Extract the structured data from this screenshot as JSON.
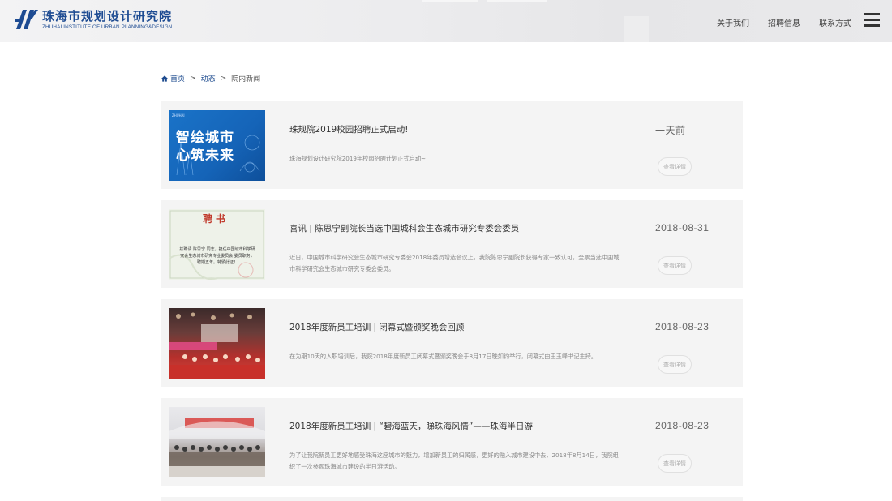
{
  "header": {
    "logo_cn": "珠海市规划设计研究院",
    "logo_en": "ZHUHAI INSTITUTE OF URBAN PLANNING&DESIGN",
    "nav": [
      "关于我们",
      "招聘信息",
      "联系方式"
    ],
    "brand_color": "#1d4b92"
  },
  "breadcrumb": {
    "home": "首页",
    "sep": ">",
    "section": "动态",
    "current": "院内新闻"
  },
  "news": [
    {
      "title": "珠规院2019校园招聘正式启动!",
      "summary": "珠海规划设计研究院2019年校园招聘计划正式启动~",
      "date": "一天前",
      "button": "查看详情",
      "thumb_text": [
        "智绘城市",
        "心筑未来"
      ],
      "thumb_small": "ZHUHAI"
    },
    {
      "title": "喜讯 | 陈思宁副院长当选中国城科会生态城市研究专委会委员",
      "summary": "近日，中国城市科学研究会生态城市研究专委会2018年委员增选会议上，我院陈思宁副院长获得专家一致认可，全票当选中国城市科学研究会生态城市研究专委会委员。",
      "date": "2018-08-31",
      "button": "查看详情",
      "thumb_text": [
        "聘书",
        "兹聘请 陈思宁 同志，担任中国城市科学研究会生态城市研究专业委员会 委员职务，聘期五年。特颁此证！"
      ]
    },
    {
      "title": "2018年度新员工培训 | 闭幕式暨颁奖晚会回顾",
      "summary": "在为期10天的入职培训后，我院2018年度新员工闭幕式暨颁奖晚会于8月17日晚如约举行，闭幕式由王玉峰书记主持。",
      "date": "2018-08-23",
      "button": "查看详情"
    },
    {
      "title": "2018年度新员工培训 | “碧海蓝天，睇珠海风情”——珠海半日游",
      "summary": "为了让我院新员工更好地感受珠海这座城市的魅力，增加新员工的归属感，更好的融入城市建设中去，2018年8月14日，我院组织了一次参观珠海城市建设的半日游活动。",
      "date": "2018-08-23",
      "button": "查看详情"
    }
  ]
}
